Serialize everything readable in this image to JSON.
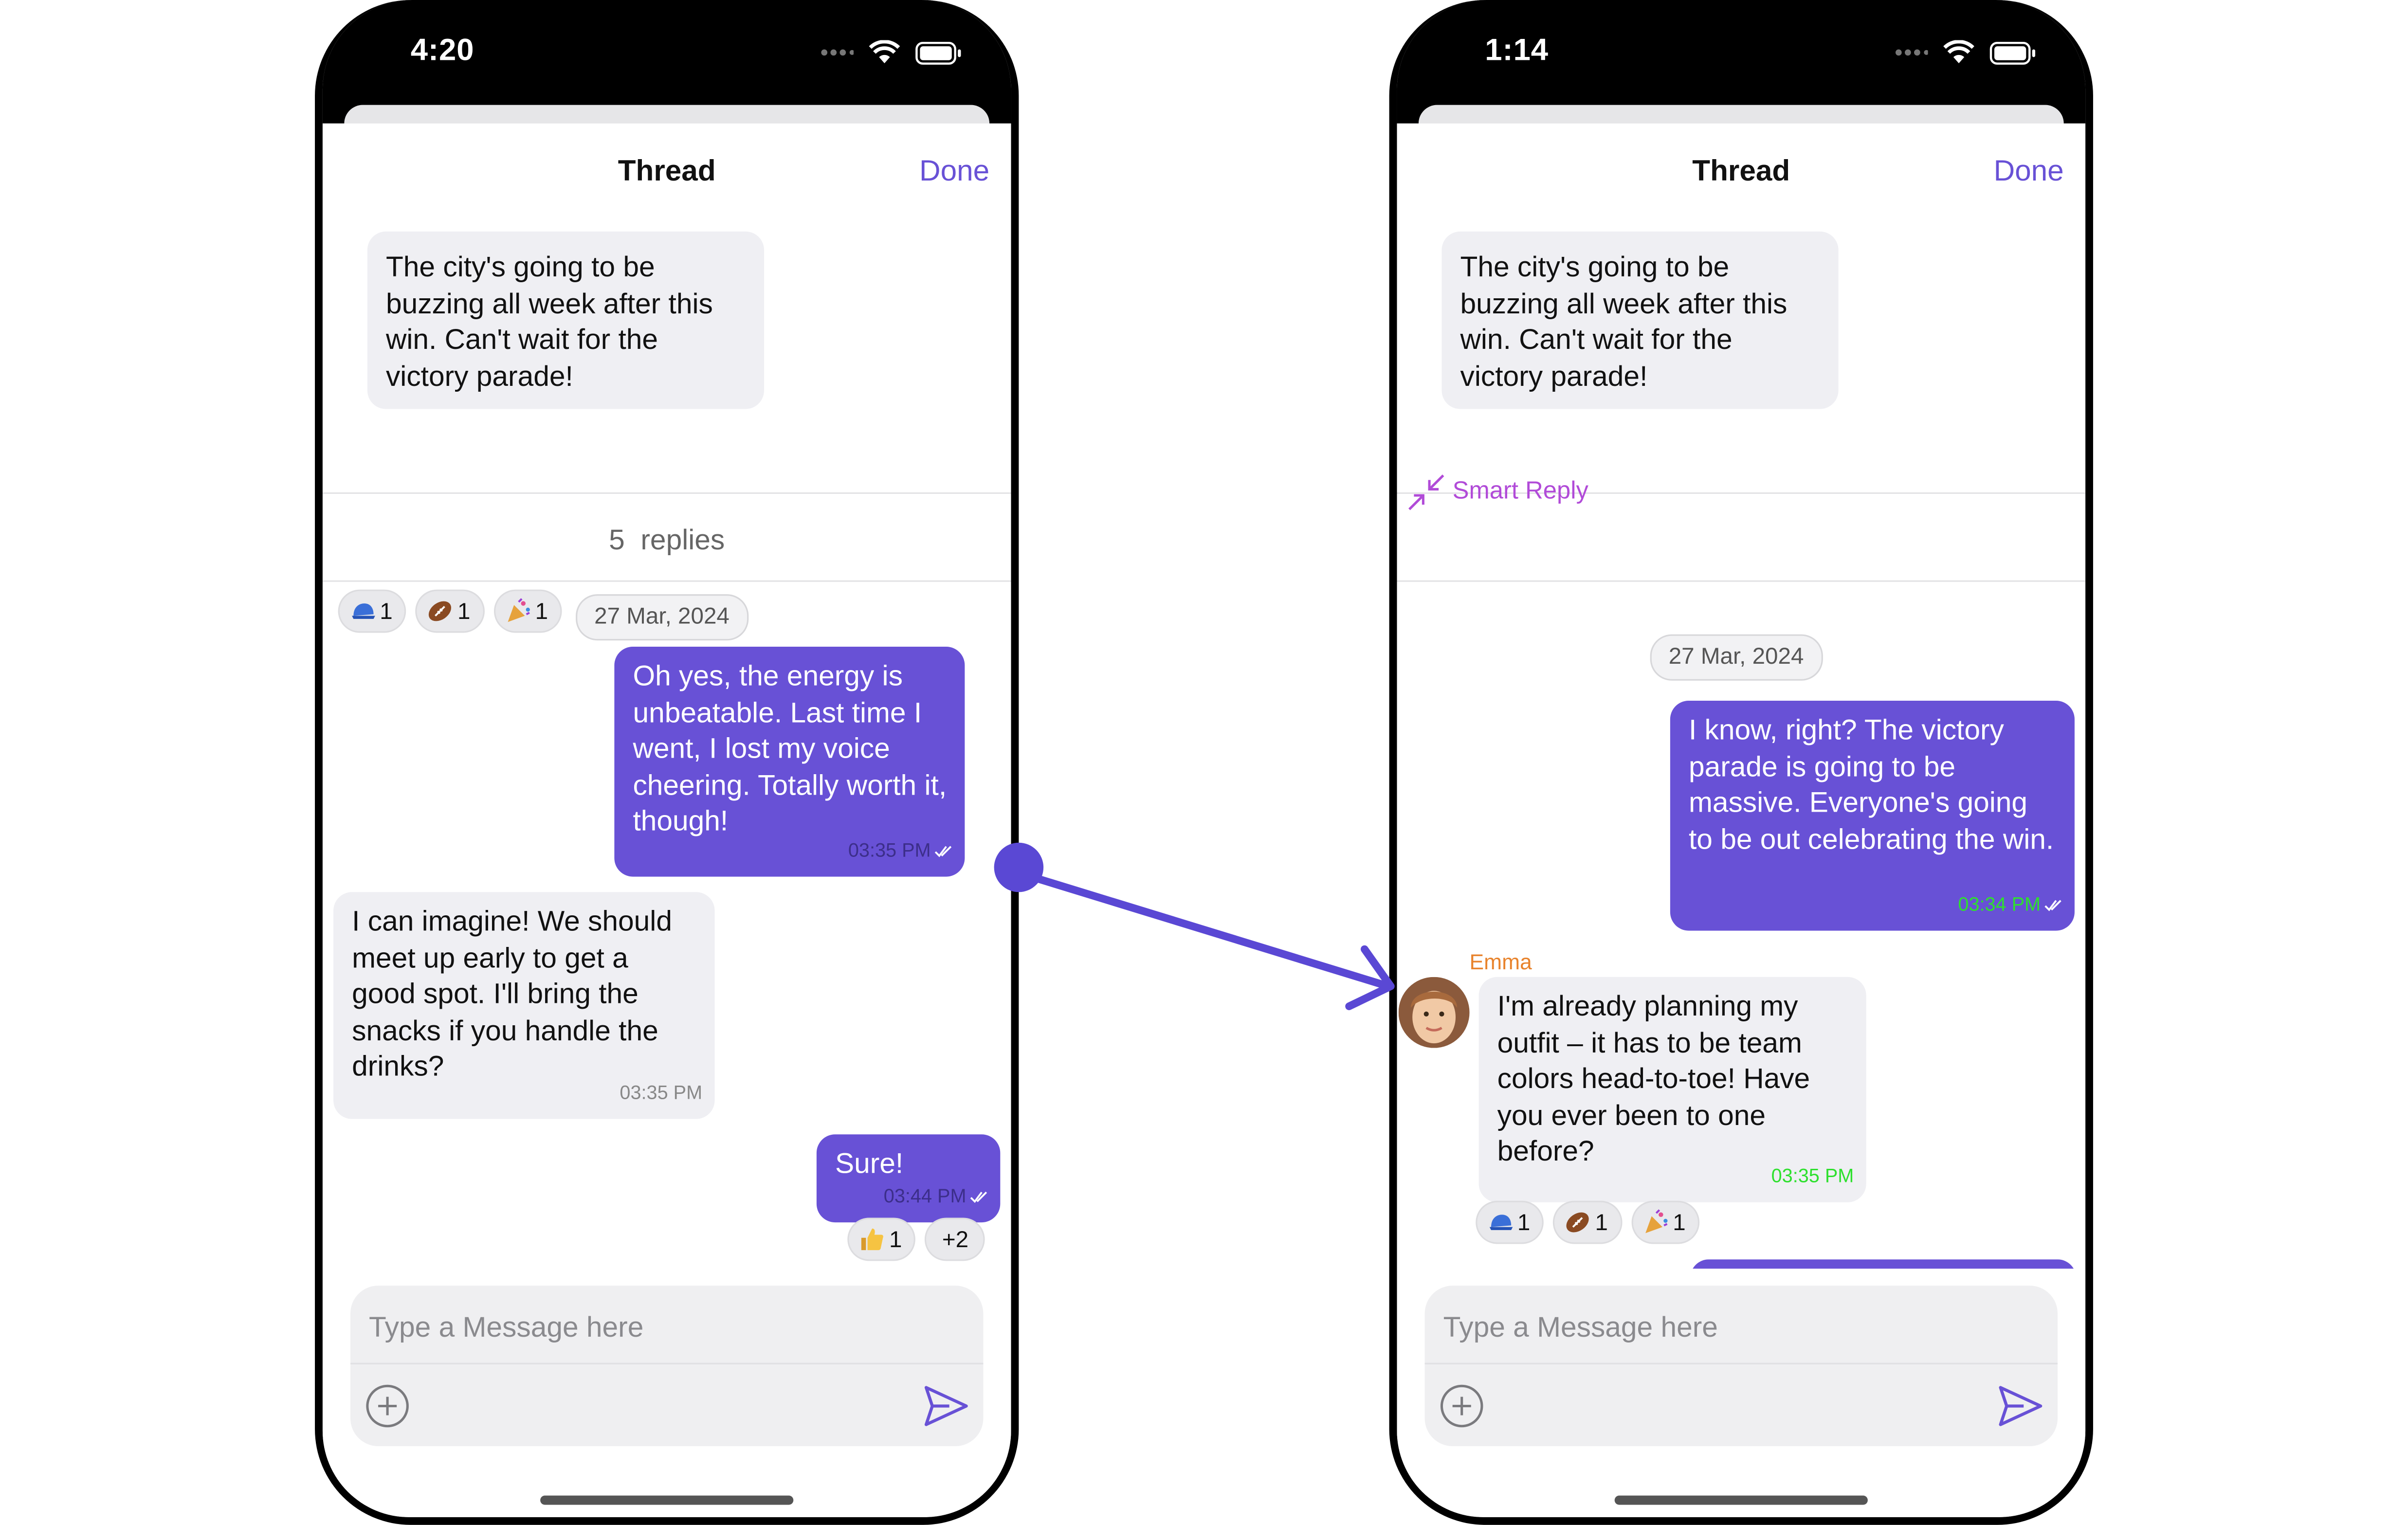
{
  "left_phone": {
    "status_time": "4:20",
    "header": {
      "title": "Thread",
      "done": "Done"
    },
    "parent_message": "The city's going to be buzzing all week after this win. Can't wait for the victory parade!",
    "replies_count": "5",
    "replies_label": "replies",
    "parent_reactions": [
      {
        "icon": "blue-cap-emoji",
        "count": "1"
      },
      {
        "icon": "football-emoji",
        "count": "1"
      },
      {
        "icon": "party-popper-emoji",
        "count": "1"
      }
    ],
    "date_separator": "27 Mar, 2024",
    "messages": [
      {
        "text": "Oh yes, the energy is unbeatable. Last time I went, I lost my voice cheering. Totally worth it, though!",
        "time": "03:35 PM"
      },
      {
        "text": "I can imagine! We should meet up early to get a good spot. I'll bring the snacks if you handle the drinks?",
        "time": "03:35 PM"
      },
      {
        "text": "Sure!",
        "time": "03:44 PM"
      }
    ],
    "last_reactions": [
      {
        "icon": "thumbs-up-emoji",
        "count": "1"
      },
      {
        "label": "+2"
      }
    ],
    "composer": {
      "placeholder": "Type a Message here"
    }
  },
  "right_phone": {
    "status_time": "1:14",
    "header": {
      "title": "Thread",
      "done": "Done"
    },
    "parent_message": "The city's going to be buzzing all week after this win. Can't wait for the victory parade!",
    "smart_reply": "Smart Reply",
    "date_separator": "27 Mar, 2024",
    "messages": [
      {
        "text": "I know, right? The victory parade is going to be massive. Everyone's going to be out celebrating the win.",
        "time": "03:34 PM"
      },
      {
        "sender": "Emma",
        "text": "I'm already planning my outfit – it has to be team colors head-to-toe! Have you ever been to one before?",
        "time": "03:35 PM"
      }
    ],
    "reactions": [
      {
        "icon": "blue-cap-emoji",
        "count": "1"
      },
      {
        "icon": "football-emoji",
        "count": "1"
      },
      {
        "icon": "party-popper-emoji",
        "count": "1"
      }
    ],
    "composer": {
      "placeholder": "Type a Message here"
    }
  },
  "colors": {
    "accent": "#6851d6",
    "bubble_incoming": "#efeff3",
    "timestamp_green": "#2ee02e",
    "sender_name": "#e8832c",
    "smart_reply": "#b14bd8"
  }
}
